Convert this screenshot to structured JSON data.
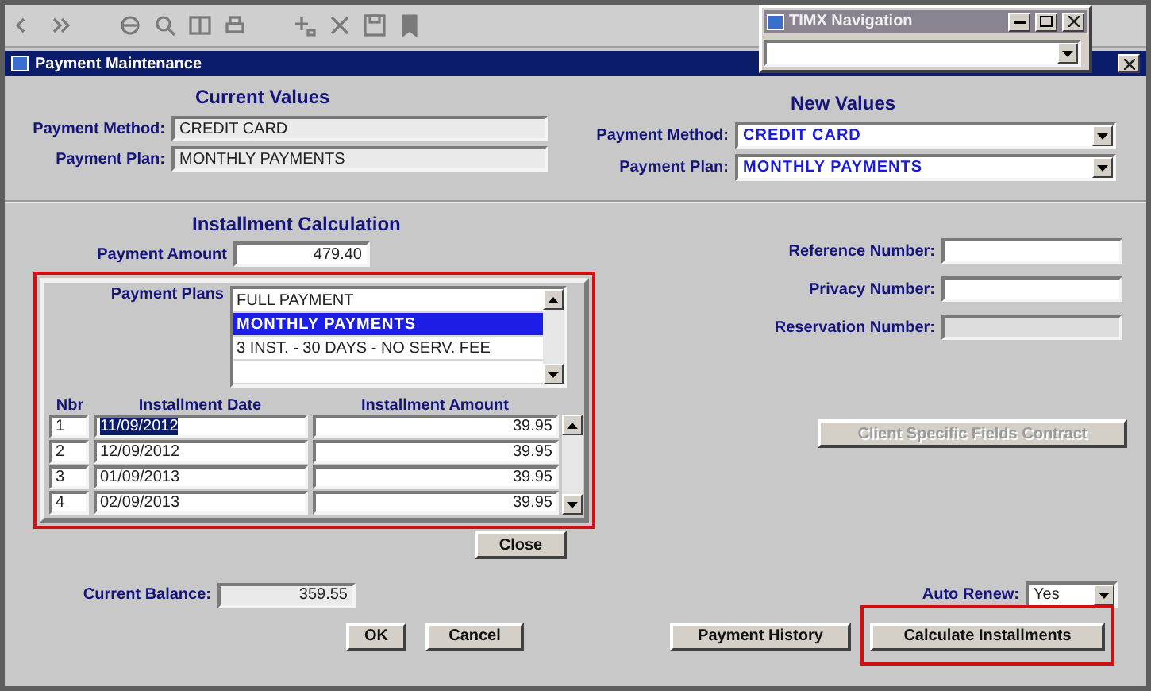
{
  "navigation_window": {
    "title": "TIMX Navigation"
  },
  "window": {
    "title": "Payment Maintenance"
  },
  "current_values": {
    "heading": "Current Values",
    "fields": [
      {
        "label": "Payment Method:",
        "value": "CREDIT CARD"
      },
      {
        "label": "Payment Plan:",
        "value": "MONTHLY PAYMENTS"
      }
    ]
  },
  "new_values": {
    "heading": "New Values",
    "fields": [
      {
        "label": "Payment Method:",
        "value": "CREDIT CARD"
      },
      {
        "label": "Payment Plan:",
        "value": "MONTHLY PAYMENTS"
      }
    ]
  },
  "installment_calculation": {
    "heading": "Installment Calculation",
    "highlighted": true,
    "payment_amount": {
      "label": "Payment Amount",
      "value": "479.40"
    },
    "payment_plans": {
      "label": "Payment Plans",
      "options": [
        {
          "text": "FULL PAYMENT",
          "selected": false
        },
        {
          "text": "MONTHLY PAYMENTS",
          "selected": true
        },
        {
          "text": "3 INST. - 30 DAYS - NO SERV. FEE",
          "selected": false
        }
      ]
    },
    "columns": [
      "Nbr",
      "Installment Date",
      "Installment Amount"
    ],
    "rows": [
      {
        "nbr": "1",
        "date": "11/09/2012",
        "amount": "39.95",
        "selected": true
      },
      {
        "nbr": "2",
        "date": "12/09/2012",
        "amount": "39.95",
        "selected": false
      },
      {
        "nbr": "3",
        "date": "01/09/2013",
        "amount": "39.95",
        "selected": false
      },
      {
        "nbr": "4",
        "date": "02/09/2013",
        "amount": "39.95",
        "selected": false
      }
    ],
    "close_button": "Close"
  },
  "reference_fields": [
    {
      "label": "Reference Number:",
      "disabled": false
    },
    {
      "label": "Privacy Number:",
      "disabled": false
    },
    {
      "label": "Reservation Number:",
      "disabled": true
    }
  ],
  "client_button": {
    "label": "Client Specific Fields Contract",
    "disabled": true
  },
  "current_balance": {
    "label": "Current Balance:",
    "value": "359.55"
  },
  "auto_renew": {
    "label": "Auto Renew:",
    "value": "Yes"
  },
  "buttons": [
    {
      "label": "OK",
      "highlighted": false
    },
    {
      "label": "Cancel",
      "highlighted": false
    },
    {
      "label": "Payment History",
      "highlighted": false
    },
    {
      "label": "Calculate Installments",
      "highlighted": true
    }
  ]
}
